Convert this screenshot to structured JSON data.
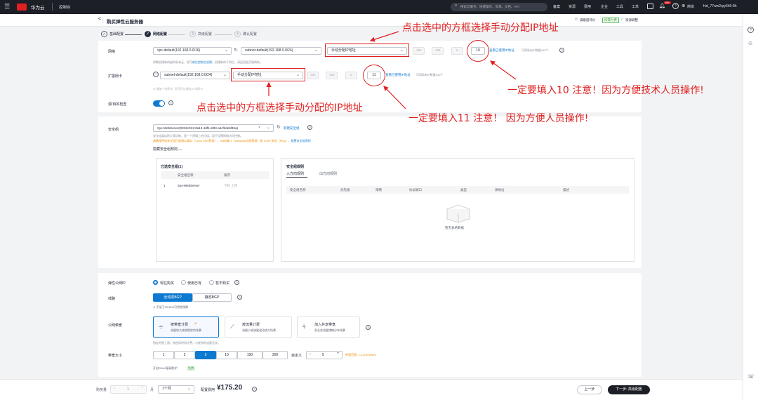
{
  "topbar": {
    "brand": "华为云",
    "console": "控制台",
    "search_placeholder": "搜索云服务、快捷操作、资源、文档、API",
    "nav": [
      "备案",
      "资源",
      "费用",
      "企业",
      "工具",
      "工单"
    ],
    "badge": "99+",
    "lang": "简体",
    "user": "hid_77ww2qry6h9-8h"
  },
  "header": {
    "back": "<",
    "title": "购买弹性云服务器",
    "right": [
      "满意度评价",
      "按需付费",
      "资源调整"
    ]
  },
  "steps": [
    {
      "num": "✓",
      "label": "基础配置"
    },
    {
      "num": "2",
      "label": "网络配置"
    },
    {
      "num": "3",
      "label": "高级配置"
    },
    {
      "num": "4",
      "label": "确认配置"
    }
  ],
  "network": {
    "label": "网络",
    "vpc": "vpc-default(192.168.0.0/16)",
    "subnet": "subnet-default(192.168.0.0/24)",
    "ip_mode": "手动分配IP地址",
    "ip": [
      "192",
      "168",
      "0",
      "10"
    ],
    "link": "查看已使用IP地址",
    "avail": "可用私有IP数量249个",
    "hint_pre": "如需创建新的虚拟私有云，您可",
    "hint_link": "前往控制台创建",
    "hint_post": "。创建新的子网后，请返回此页面刷新。"
  },
  "ext_nic": {
    "label": "扩展网卡",
    "subnet": "subnet-default(192.168.0.0/24)",
    "ip_mode": "手动分配IP地址",
    "ip": [
      "192",
      "168",
      "0",
      "11"
    ],
    "link": "查看已使用IP地址",
    "avail": "可用私有IP数量249个",
    "add": "增加一块网卡",
    "add_hint": "您还可以增加 0 块网卡"
  },
  "source_check": {
    "label": "源/目的检查"
  },
  "security": {
    "label": "安全组",
    "value": "Sys-WebServer(0233c313-0a13-4df4-af03-a4cf2de6f45a)",
    "tag": "×",
    "new_link": "新建安全组",
    "hint1": "安全组类似防火墙功能，是一个逻辑上的分组，用于设置网络访问控制。",
    "hint2_pre": "请确保所选安全组已放通22端口（Linux SSH登录），3389端口（Windows远程登录）和 ICMP 协议（Ping）。",
    "hint2_link": "配置安全组规则",
    "toggle": "隐藏安全组规则",
    "selected_title": "已选安全组(1)",
    "sel_cols": [
      "安全组名称",
      "排序"
    ],
    "sel_rows": [
      {
        "idx": "1",
        "name": "Sys-WebServer",
        "ops": "下移  上移"
      }
    ],
    "rules_title": "安全组规则",
    "tabs": [
      "入方向规则",
      "出方向规则"
    ],
    "rule_cols": [
      "安全组名称",
      "优先级",
      "策略",
      "协议端口",
      "类型",
      "源地址",
      "描述"
    ],
    "empty": "暂无表格数据"
  },
  "eip": {
    "label": "弹性公网IP",
    "options": [
      "现在购买",
      "使用已有",
      "暂不购买"
    ],
    "line_label": "线路",
    "line_options": [
      "全动态BGP",
      "静态BGP"
    ],
    "sla": "不低于99.95%可用性保障",
    "billing_label": "公网带宽",
    "billing": [
      {
        "title": "按带宽计费",
        "desc": "流量较大或较稳定的场景"
      },
      {
        "title": "按流量计费",
        "desc": "流量小或流量波动较大场景"
      },
      {
        "title": "加入共享带宽",
        "desc": "多业务流量错峰分布场景"
      }
    ],
    "billing_hint": "指定带宽上限，按使用时间计费，与使用的流量无关。",
    "bw_label": "带宽大小",
    "bw_options": [
      "1",
      "2",
      "5",
      "10",
      "100",
      "200"
    ],
    "bw_custom": "自定义",
    "bw_value": "5",
    "bw_range": "带宽范围: 1-2,000 Mbit/s",
    "ddos": "开启DDoS基础防护",
    "ddos_tag": "免费"
  },
  "footer": {
    "qty_label": "购买量",
    "qty": "1",
    "month_label": "月",
    "duration": "1个月",
    "price_label": "配置费用",
    "price": "¥175.20",
    "prev": "上一步",
    "next": "下一步: 高级配置"
  },
  "annotations": {
    "a1": "点击选中的方框选择手动分配IP地址",
    "a2": "点击选中的方框选择手动分配的IP地址",
    "a3": "一定要填入10 注意！因为方便技术人员操作!",
    "a4": "一定要填入11 注意！ 因为方便人员操作!"
  },
  "colors": {
    "primary": "#0d79d1",
    "red": "#e02020",
    "dark": "#1c1f26"
  }
}
